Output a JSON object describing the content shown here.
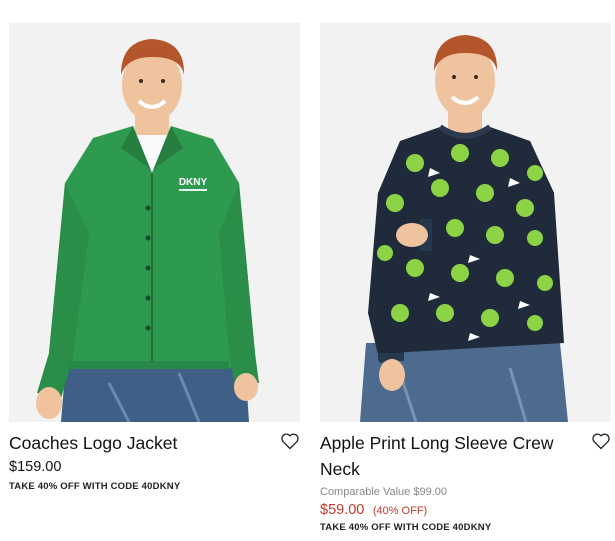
{
  "products": [
    {
      "title": "Coaches Logo Jacket",
      "price": "$159.00",
      "promo": "TAKE 40% OFF WITH CODE 40DKNY",
      "logo_text": "DKNY",
      "colors": {
        "jacket": "#2e9a4f",
        "jeans": "#3f5f86",
        "hair": "#b3562c",
        "skin": "#f0c39f"
      }
    },
    {
      "title": "Apple Print Long Sleeve Crew Neck",
      "comparable": "Comparable Value $99.00",
      "sale_price": "$59.00",
      "discount": "(40% OFF)",
      "promo": "TAKE 40% OFF WITH CODE 40DKNY",
      "colors": {
        "sweater": "#1f2b3b",
        "apple": "#8cd446",
        "jeans": "#4d6a8f",
        "hair": "#b3562c",
        "skin": "#f0c39f",
        "sale": "#c0392b"
      }
    }
  ],
  "icons": {
    "wishlist": "heart-outline-icon"
  }
}
